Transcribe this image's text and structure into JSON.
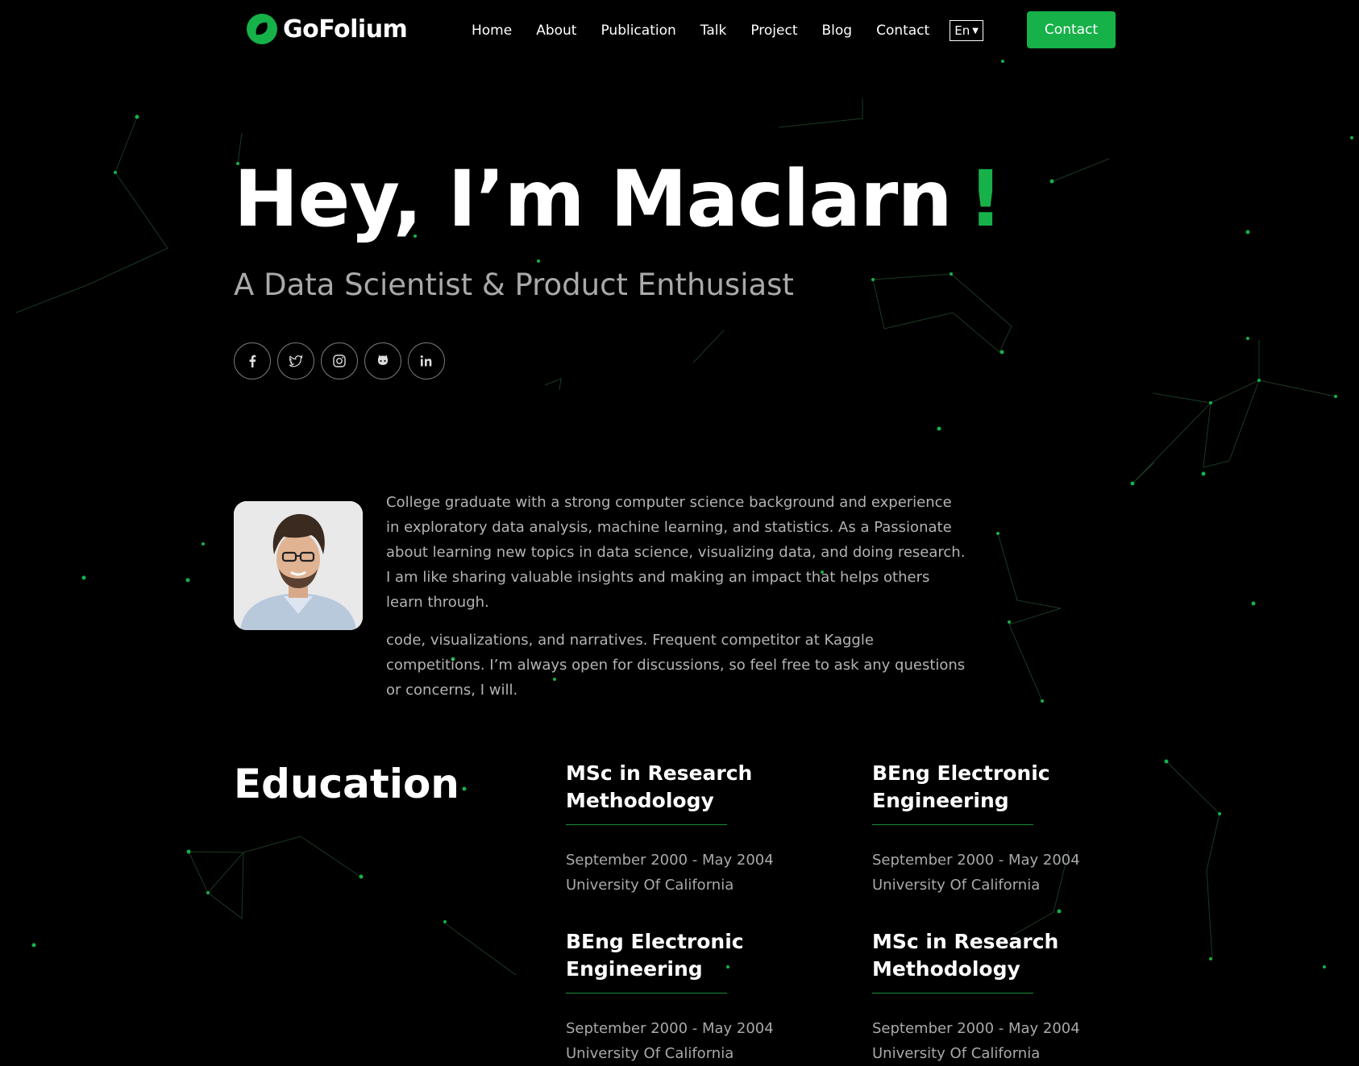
{
  "brand": {
    "name": "GoFolium",
    "accent_color": "#16b148",
    "logo_icon": "ring-logo-icon"
  },
  "nav": {
    "items": [
      "Home",
      "About",
      "Publication",
      "Talk",
      "Project",
      "Blog",
      "Contact"
    ],
    "language": "En",
    "cta_label": "Contact"
  },
  "hero": {
    "title": "Hey, I’m Maclarn",
    "title_accent": "!",
    "subtitle": "A Data Scientist & Product Enthusiast"
  },
  "social_icons": [
    "facebook-icon",
    "twitter-icon",
    "instagram-icon",
    "github-icon",
    "linkedin-icon"
  ],
  "about": {
    "paragraphs": [
      "College graduate with a strong computer science background and experience in exploratory data analysis, machine learning, and statistics. As a Passionate about learning new topics in data science, visualizing data, and doing research. I am like sharing valuable insights and making an impact that helps others learn through.",
      "code, visualizations, and narratives. Frequent competitor at Kaggle competitions. I’m always open for discussions, so feel free to ask any questions or concerns, I will."
    ]
  },
  "education": {
    "heading": "Education",
    "items": [
      {
        "degree": "MSc in Research Methodology",
        "dates": "September 2000 - May 2004",
        "school": "University Of California"
      },
      {
        "degree": "BEng Electronic Engineering",
        "dates": "September 2000 - May 2004",
        "school": "University Of California"
      },
      {
        "degree": "BEng Electronic Engineering",
        "dates": "September 2000 - May 2004",
        "school": "University Of California"
      },
      {
        "degree": "MSc in Research Methodology",
        "dates": "September 2000 - May 2004",
        "school": "University Of California"
      }
    ]
  }
}
